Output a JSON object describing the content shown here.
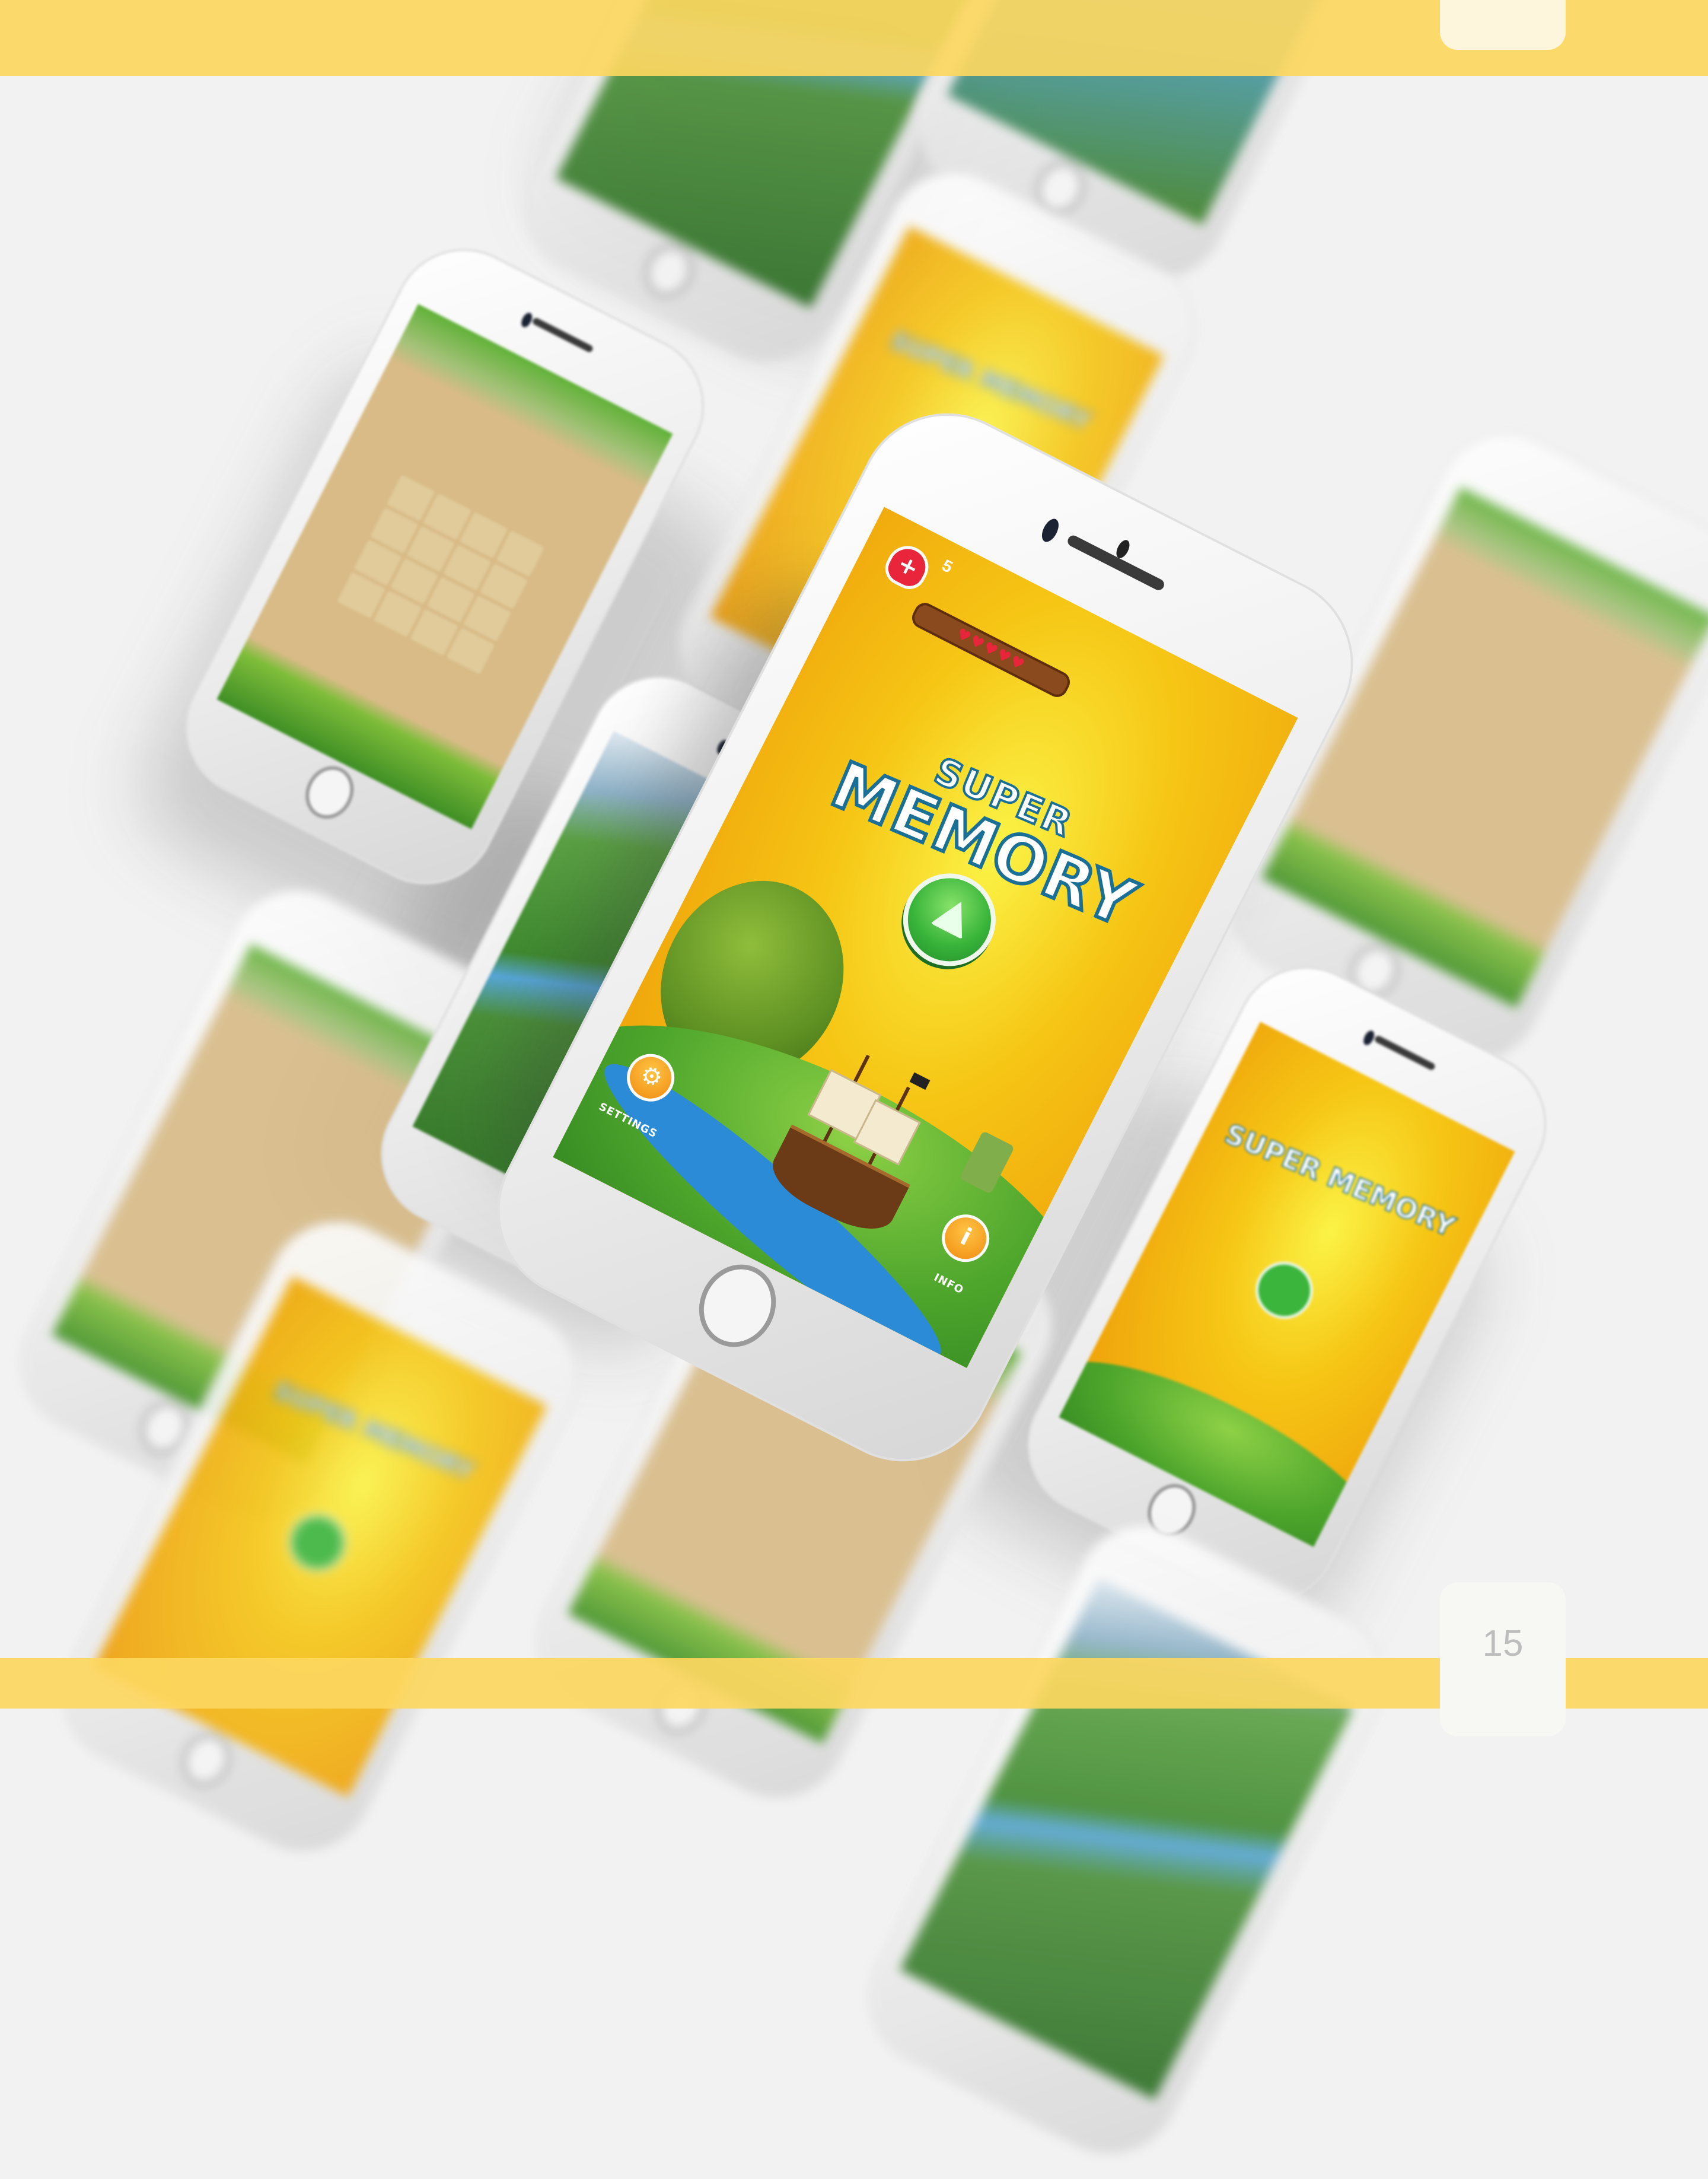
{
  "page_number": "15",
  "main_phone": {
    "lives_count": "5",
    "hearts": "♥♥♥♥♥",
    "logo_line1": "SUPER",
    "logo_line2": "MEMORY",
    "settings_label": "SETTINGS",
    "info_label": "INFO",
    "colors": {
      "accent_yellow": "#fcd75f",
      "play_green": "#39b43a",
      "button_orange": "#f08a0e",
      "heart_red": "#e8253b"
    }
  },
  "icons": [
    "heart-icon",
    "plus-icon",
    "play-icon",
    "gear-icon",
    "info-icon"
  ],
  "background_phones": [
    {
      "screen": "map"
    },
    {
      "screen": "map"
    },
    {
      "screen": "board"
    },
    {
      "screen": "title"
    },
    {
      "screen": "map"
    },
    {
      "screen": "board"
    },
    {
      "screen": "board"
    },
    {
      "screen": "title"
    },
    {
      "screen": "title"
    },
    {
      "screen": "board"
    }
  ]
}
